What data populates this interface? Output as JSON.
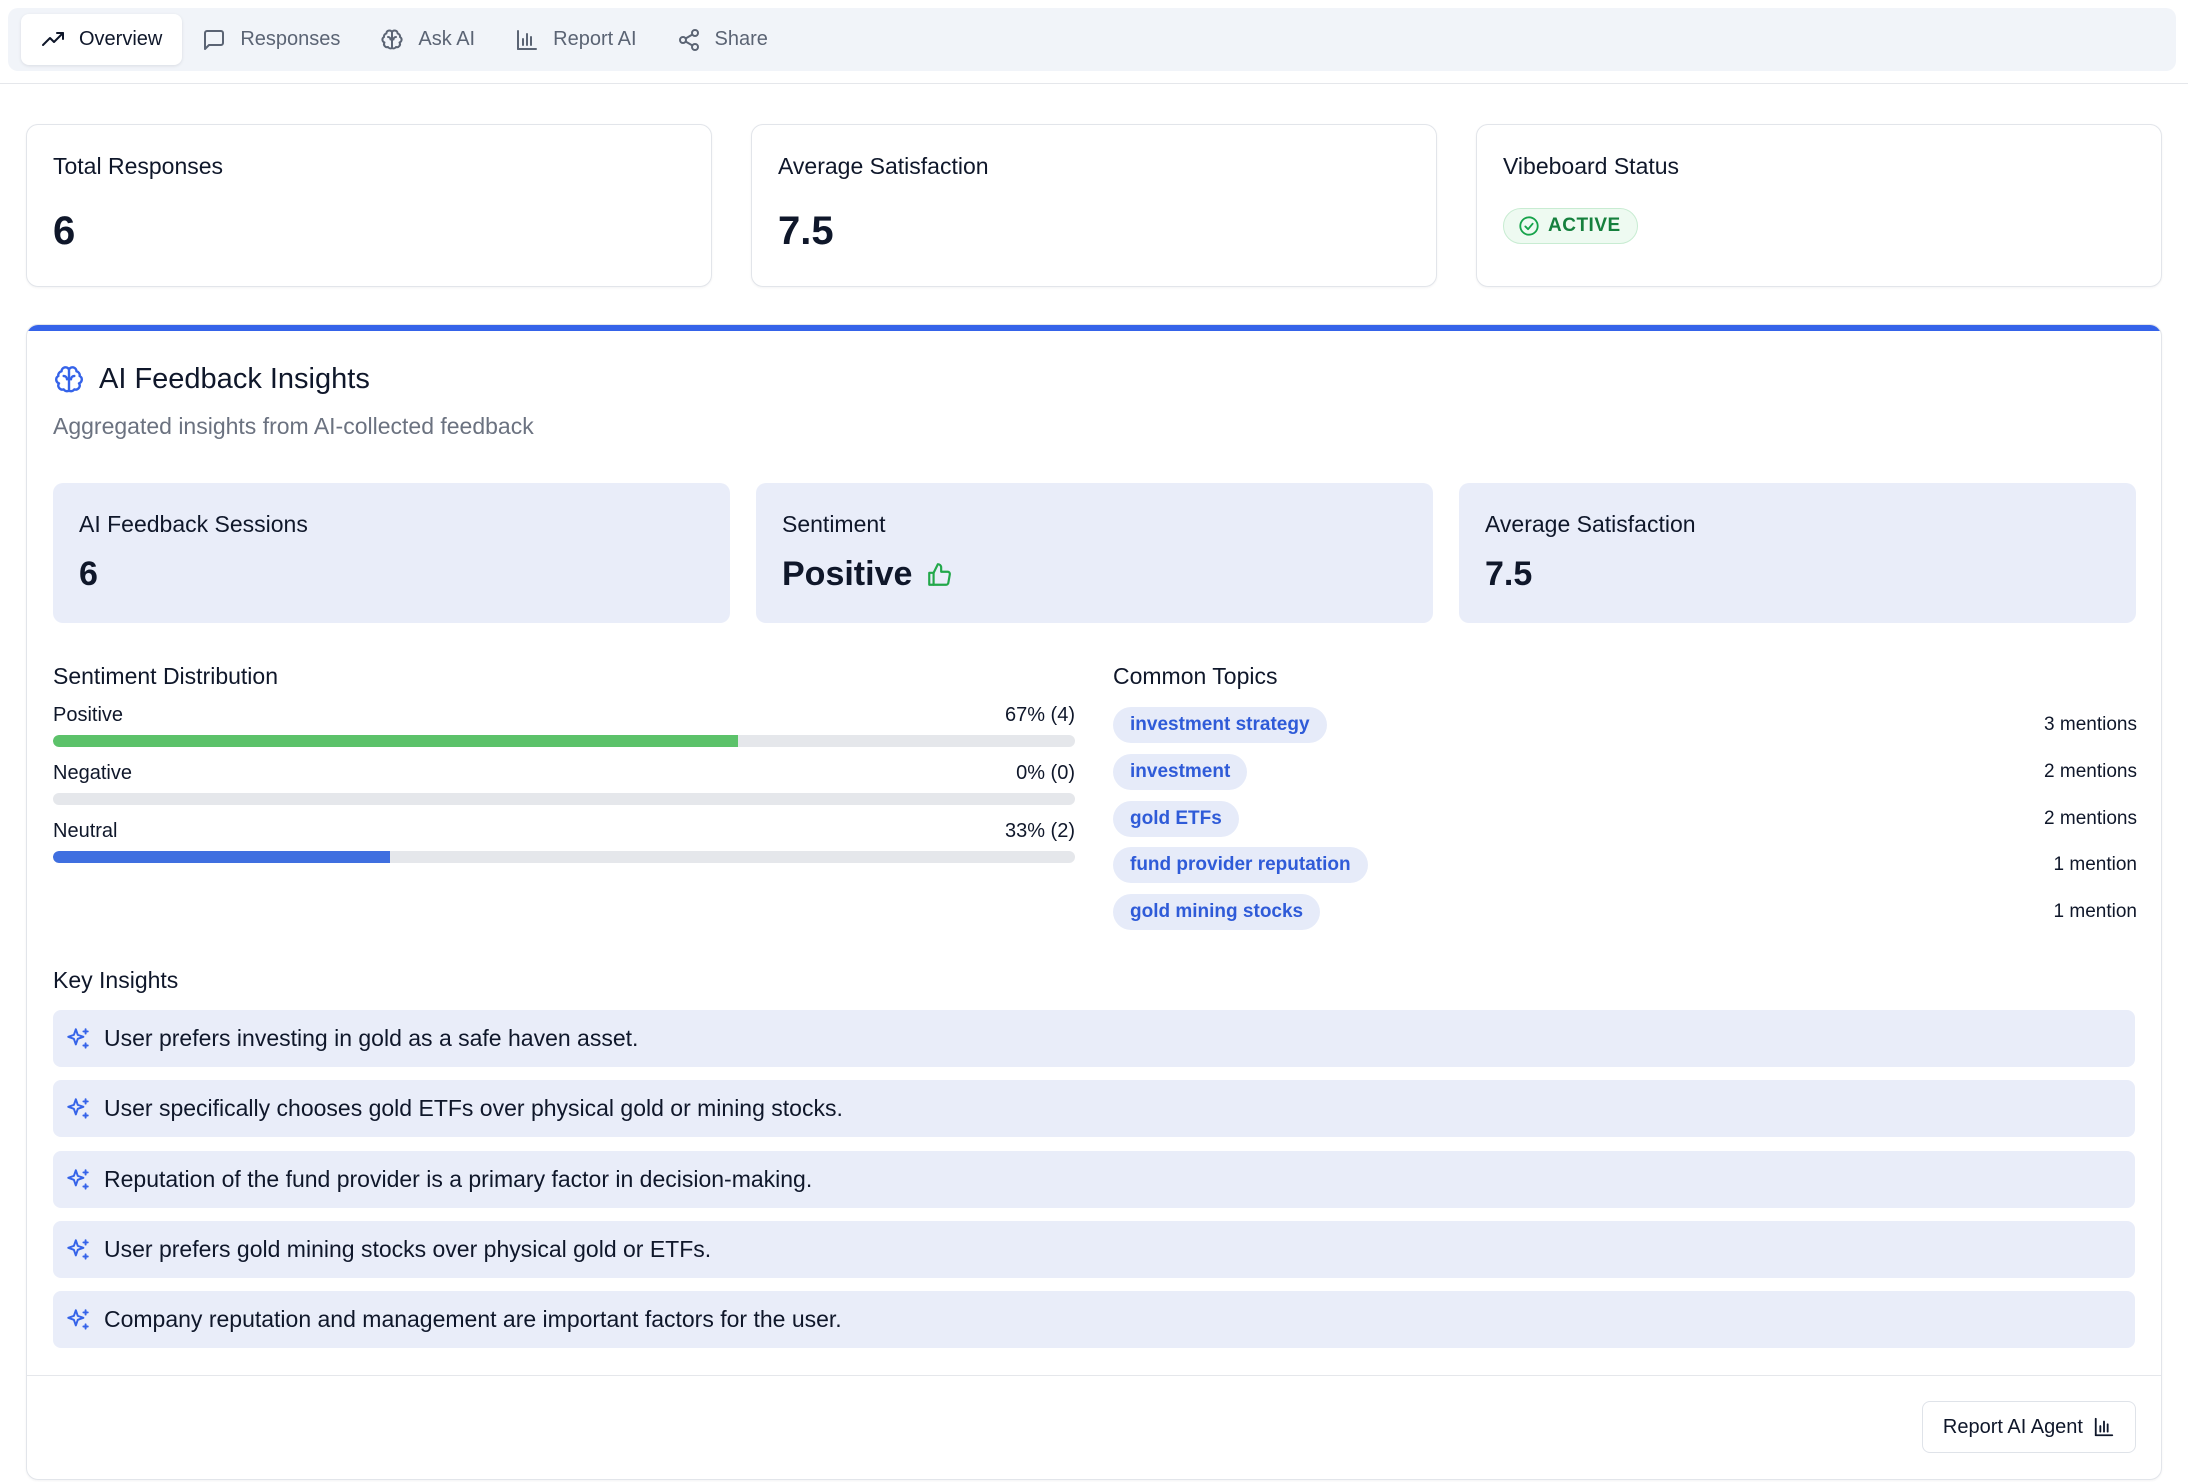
{
  "tabs": [
    {
      "label": "Overview",
      "icon": "trending-up-icon",
      "active": true
    },
    {
      "label": "Responses",
      "icon": "message-square-icon",
      "active": false
    },
    {
      "label": "Ask AI",
      "icon": "brain-icon",
      "active": false
    },
    {
      "label": "Report AI",
      "icon": "bar-chart-icon",
      "active": false
    },
    {
      "label": "Share",
      "icon": "share-icon",
      "active": false
    }
  ],
  "stats": {
    "total_responses": {
      "label": "Total Responses",
      "value": "6"
    },
    "average_satisfaction": {
      "label": "Average Satisfaction",
      "value": "7.5"
    },
    "vibeboard_status": {
      "label": "Vibeboard Status",
      "value": "ACTIVE"
    }
  },
  "insights": {
    "title": "AI Feedback Insights",
    "subtitle": "Aggregated insights from AI-collected feedback",
    "summary": {
      "sessions": {
        "label": "AI Feedback Sessions",
        "value": "6"
      },
      "sentiment": {
        "label": "Sentiment",
        "value": "Positive"
      },
      "satisfaction": {
        "label": "Average Satisfaction",
        "value": "7.5"
      }
    },
    "distribution_heading": "Sentiment Distribution",
    "distribution": [
      {
        "name": "Positive",
        "display": "67% (4)",
        "percent": 67,
        "color": "#5cc26a"
      },
      {
        "name": "Negative",
        "display": "0% (0)",
        "percent": 0,
        "color": "#e05252"
      },
      {
        "name": "Neutral",
        "display": "33% (2)",
        "percent": 33,
        "color": "#3f6fe0"
      }
    ],
    "topics_heading": "Common Topics",
    "topics": [
      {
        "label": "investment strategy",
        "count": "3 mentions"
      },
      {
        "label": "investment",
        "count": "2 mentions"
      },
      {
        "label": "gold ETFs",
        "count": "2 mentions"
      },
      {
        "label": "fund provider reputation",
        "count": "1 mention"
      },
      {
        "label": "gold mining stocks",
        "count": "1 mention"
      }
    ],
    "key_insights_heading": "Key Insights",
    "key_insights": [
      "User prefers investing in gold as a safe haven asset.",
      "User specifically chooses gold ETFs over physical gold or mining stocks.",
      "Reputation of the fund provider is a primary factor in decision-making.",
      "User prefers gold mining stocks over physical gold or ETFs.",
      "Company reputation and management are important factors for the user."
    ],
    "report_button": "Report AI Agent"
  }
}
